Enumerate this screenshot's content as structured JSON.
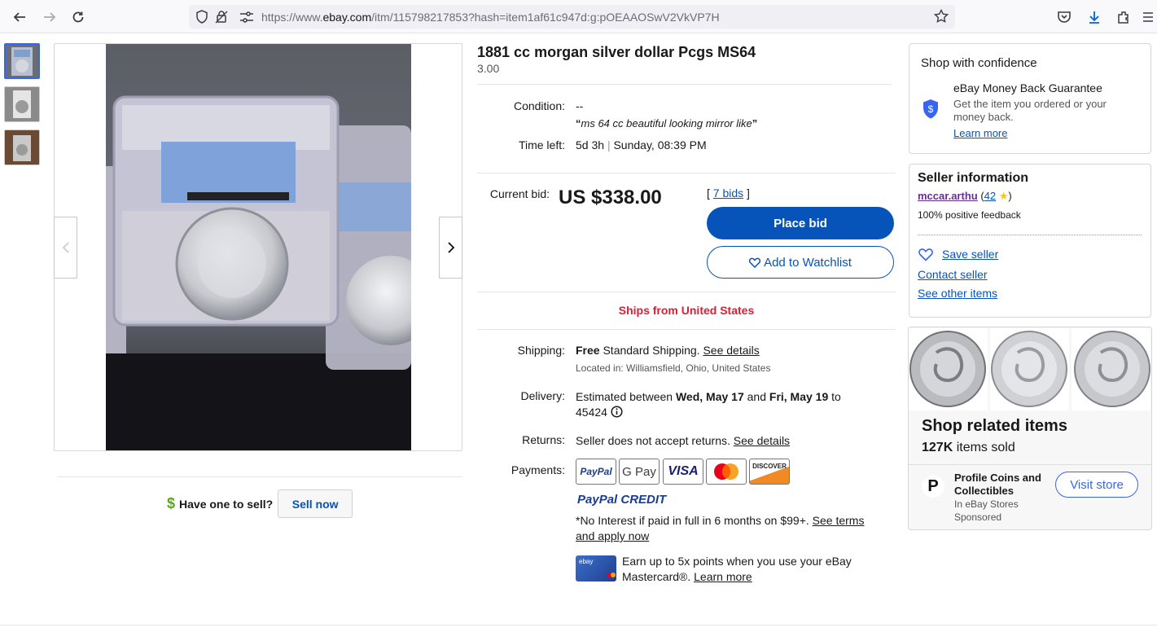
{
  "browser": {
    "url_prefix": "https://www.",
    "url_domain": "ebay.com",
    "url_rest": "/itm/115798217853?hash=item1af61c947d:g:pOEAAOSwV2VkVP7H"
  },
  "listing": {
    "title": "1881 cc morgan silver dollar Pcgs MS64",
    "subtitle": "3.00",
    "condition_label": "Condition:",
    "condition_value": "--",
    "condition_quote_open": "“",
    "condition_quote": "ms 64 cc beautiful looking mirror like",
    "condition_quote_close": "”",
    "time_left_label": "Time left:",
    "time_left_value": "5d 3h",
    "time_left_date": "Sunday, 08:39 PM",
    "current_bid_label": "Current bid:",
    "price": "US $338.00",
    "bids_open": "[ ",
    "bids_link": "7 bids",
    "bids_close": " ]",
    "place_bid": "Place bid",
    "watchlist": "Add to Watchlist",
    "ships_from": "Ships from United States",
    "shipping_label": "Shipping:",
    "shipping_free": "Free",
    "shipping_text": " Standard Shipping. ",
    "see_details": "See details",
    "located_in": "Located in: Williamsfield, Ohio, United States",
    "delivery_label": "Delivery:",
    "delivery_pre": "Estimated between ",
    "delivery_date1": "Wed, May 17",
    "delivery_and": " and ",
    "delivery_date2": "Fri, May 19",
    "delivery_to": " to",
    "delivery_zip": "45424",
    "returns_label": "Returns:",
    "returns_text": "Seller does not accept returns. ",
    "returns_link": "See details",
    "payments_label": "Payments:",
    "payments": [
      "PayPal",
      "G Pay",
      "VISA",
      "Mastercard",
      "DISCOVER"
    ],
    "paypal_credit": "PayPal CREDIT",
    "no_interest": "*No Interest if paid in full in 6 months on $99+. ",
    "see_terms": "See terms",
    "and_apply": "and apply now",
    "earn_points": "Earn up to 5x points when you use your eBay",
    "mastercard": "Mastercard®. ",
    "learn_more": "Learn more",
    "card_brand": "ebay"
  },
  "sell": {
    "question": "Have one to sell?",
    "button": "Sell now"
  },
  "confidence": {
    "heading": "Shop with confidence",
    "guarantee_title": "eBay Money Back Guarantee",
    "guarantee_text1": "Get the item you ordered or your",
    "guarantee_text2": "money back.",
    "learn_more": "Learn more"
  },
  "seller": {
    "heading": "Seller information",
    "name": "mccar.arthu",
    "feedback_open": " (",
    "feedback_score": "42",
    "feedback_close": ")",
    "positive": "100% positive feedback",
    "save_seller": "Save seller",
    "contact": "Contact seller",
    "other_items": "See other items"
  },
  "related": {
    "heading": "Shop related items",
    "sold_count": "127K",
    "sold_label": " items sold",
    "store_name1": "Profile Coins and",
    "store_name2": "Collectibles",
    "store_sub": "In eBay Stores",
    "sponsored": "Sponsored",
    "visit_store": "Visit store",
    "store_logo": "P"
  },
  "colors": {
    "ebay_blue": "#0654ba",
    "ships_red": "#dd1e31"
  }
}
